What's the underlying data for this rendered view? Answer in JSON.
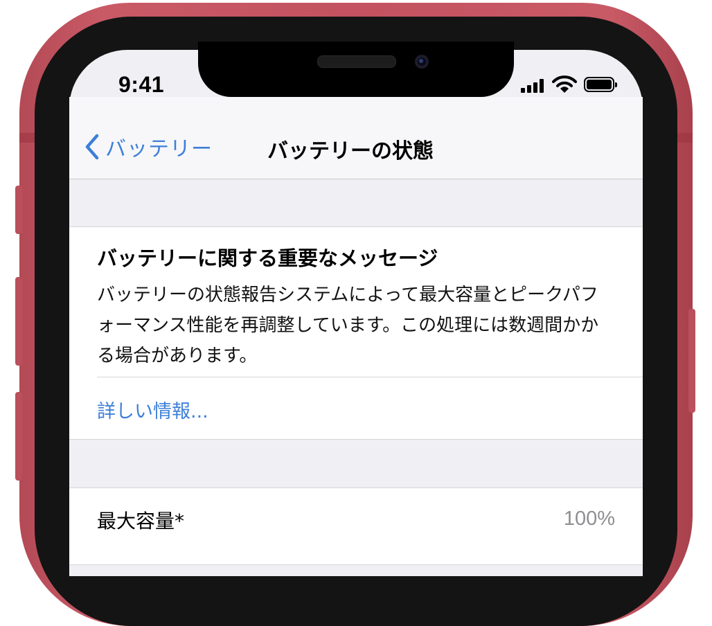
{
  "status_bar": {
    "time": "9:41",
    "icons": [
      "cellular-signal-icon",
      "wifi-icon",
      "battery-icon"
    ]
  },
  "nav": {
    "back_label": "バッテリー",
    "title": "バッテリーの状態"
  },
  "message_card": {
    "title": "バッテリーに関する重要なメッセージ",
    "body": "バッテリーの状態報告システムによって最大容量とピークパフォーマンス性能を再調整しています。この処理には数週間かかる場合があります。",
    "link": "詳しい情報..."
  },
  "capacity_row": {
    "label": "最大容量*",
    "value": "100%"
  },
  "colors": {
    "accent": "#3d7fd8",
    "frame": "#c45260",
    "background": "#efeff4"
  }
}
